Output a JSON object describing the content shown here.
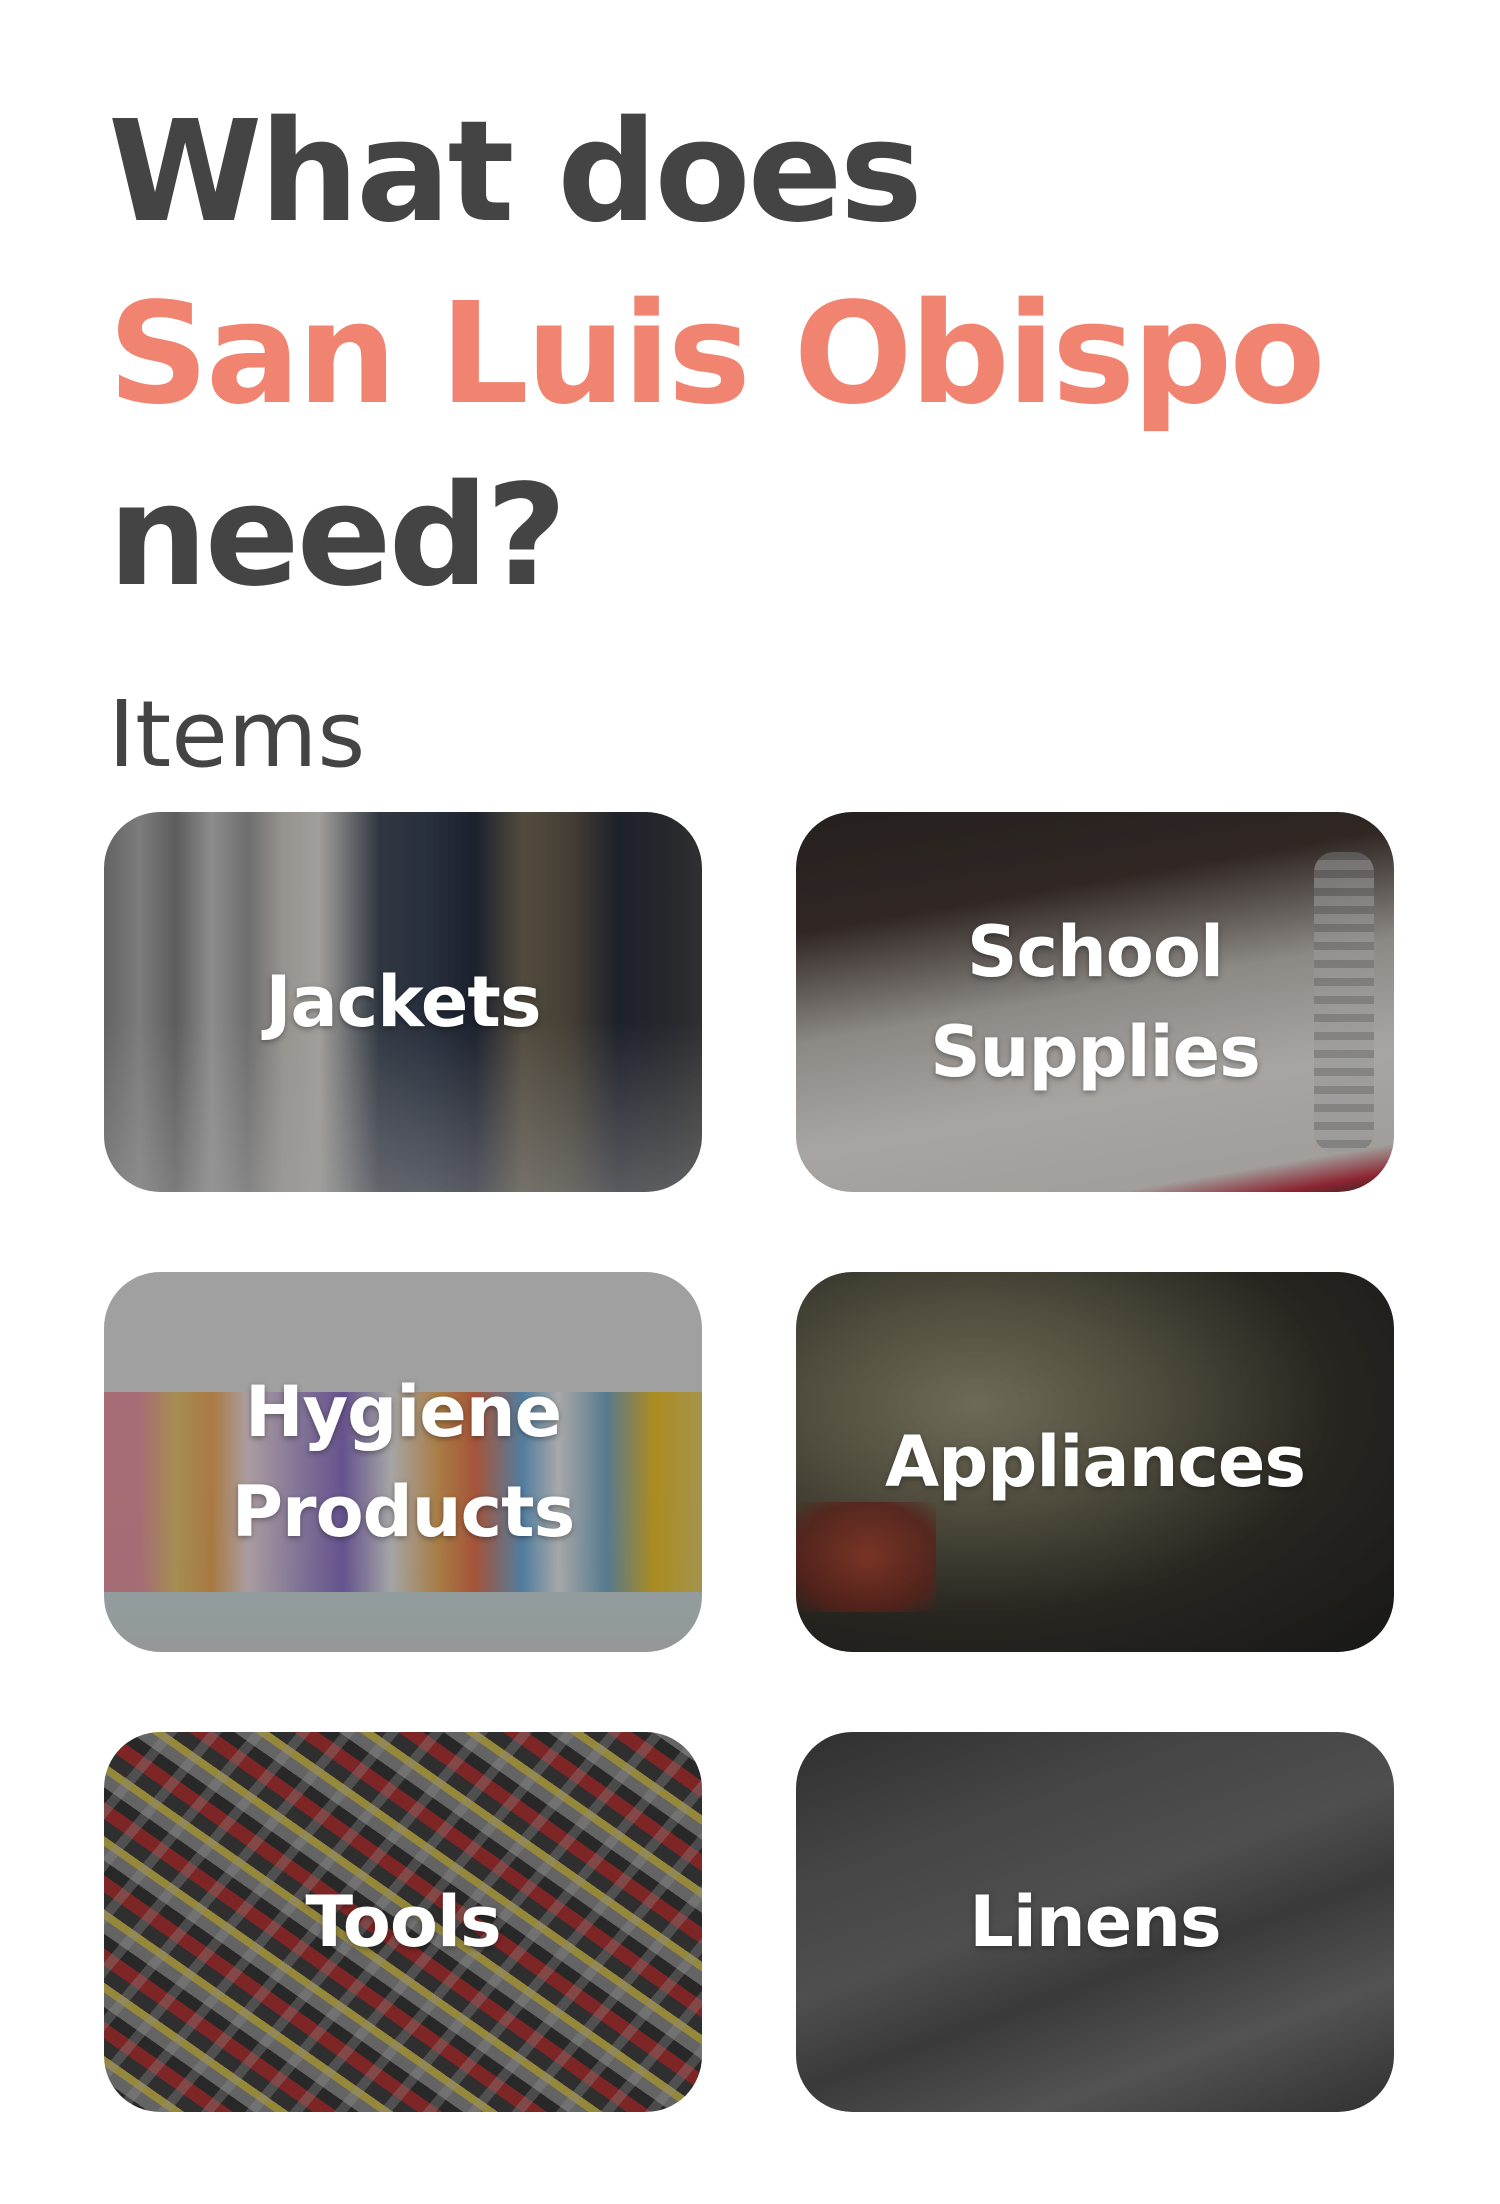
{
  "header": {
    "line1": "What does",
    "city": "San Luis Obispo",
    "line3": "need?"
  },
  "section": {
    "title": "Items"
  },
  "categories": [
    {
      "label": "Jackets"
    },
    {
      "label": "School Supplies"
    },
    {
      "label": "Hygiene Products"
    },
    {
      "label": "Appliances"
    },
    {
      "label": "Tools"
    },
    {
      "label": "Linens"
    }
  ],
  "colors": {
    "text": "#444444",
    "accent": "#f08470",
    "card_label": "#ffffff"
  }
}
